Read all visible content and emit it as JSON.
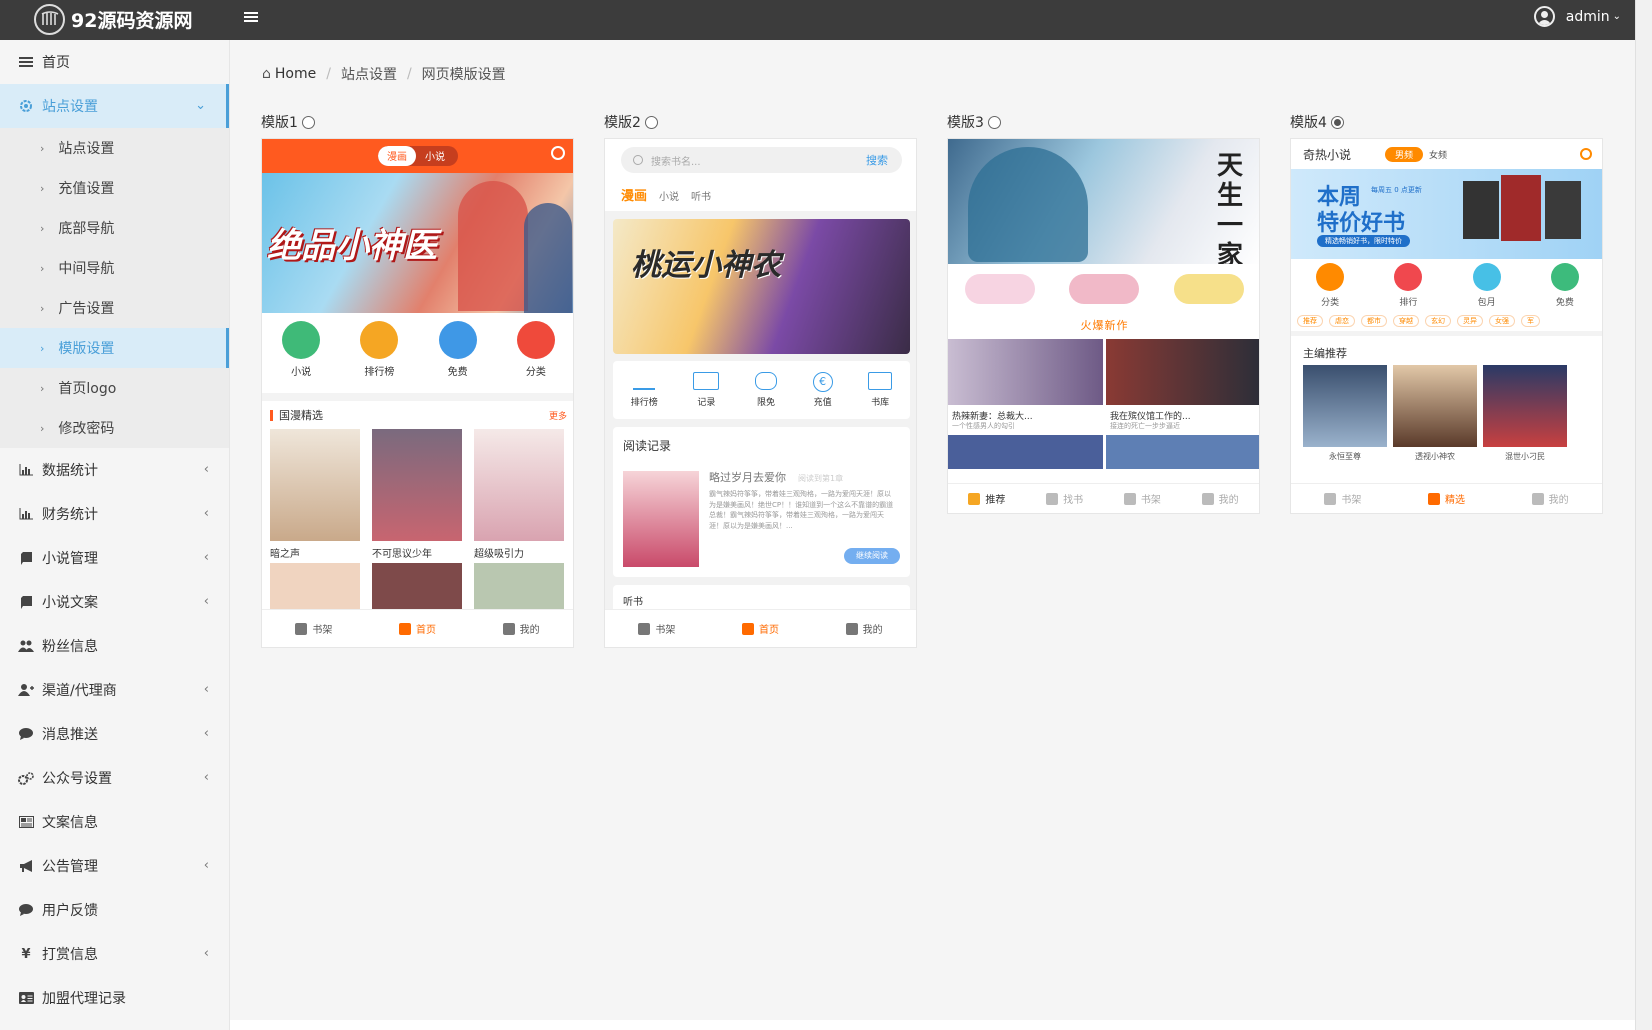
{
  "header": {
    "logo_text": "92源码资源网",
    "user": "admin"
  },
  "sidebar": {
    "items": [
      {
        "label": "首页",
        "icon": "list-icon"
      },
      {
        "label": "站点设置",
        "icon": "gear-icon"
      },
      {
        "label": "数据统计",
        "icon": "bar-chart-icon"
      },
      {
        "label": "财务统计",
        "icon": "bar-chart-icon"
      },
      {
        "label": "小说管理",
        "icon": "book-icon"
      },
      {
        "label": "小说文案",
        "icon": "book-icon"
      },
      {
        "label": "粉丝信息",
        "icon": "users-icon"
      },
      {
        "label": "渠道/代理商",
        "icon": "user-plus-icon"
      },
      {
        "label": "消息推送",
        "icon": "comment-icon"
      },
      {
        "label": "公众号设置",
        "icon": "cogs-icon"
      },
      {
        "label": "文案信息",
        "icon": "newspaper-icon"
      },
      {
        "label": "公告管理",
        "icon": "bullhorn-icon"
      },
      {
        "label": "用户反馈",
        "icon": "comment-icon"
      },
      {
        "label": "打赏信息",
        "icon": "yen-icon"
      },
      {
        "label": "加盟代理记录",
        "icon": "id-card-icon"
      }
    ],
    "sub_items": [
      "站点设置",
      "充值设置",
      "底部导航",
      "中间导航",
      "广告设置",
      "模版设置",
      "首页logo",
      "修改密码"
    ]
  },
  "breadcrumb": {
    "home": "Home",
    "level1": "站点设置",
    "level2": "网页模版设置"
  },
  "templates": [
    {
      "label": "模版1",
      "selected": false
    },
    {
      "label": "模版2",
      "selected": false
    },
    {
      "label": "模版3",
      "selected": false
    },
    {
      "label": "模版4",
      "selected": true
    }
  ],
  "t1": {
    "tab_active": "漫画",
    "tab_other": "小说",
    "banner_title": "绝品小神医",
    "icons": [
      "小说",
      "排行榜",
      "免费",
      "分类"
    ],
    "section": "国漫精选",
    "more": "更多",
    "books": [
      "暗之声",
      "不可思议少年",
      "超级吸引力"
    ],
    "tabs": [
      "书架",
      "首页",
      "我的"
    ]
  },
  "t2": {
    "search_placeholder": "搜索书名...",
    "search_btn": "搜索",
    "tabs_top": [
      "漫画",
      "小说",
      "听书"
    ],
    "banner_title": "桃运小神农",
    "icons": [
      "排行榜",
      "记录",
      "限免",
      "充值",
      "书库"
    ],
    "history_title": "阅读记录",
    "book_title": "略过岁月去爱你",
    "book_progress": "阅读到第1章",
    "book_desc": "霸气辣妈符筝筝，带着娃三观殉格，一路为爱闯天涯！原以为是嫌美画风！绝世CP！！谁知道到一个这么不靠谱的霸道总裁！霸气辣妈符筝筝，带着娃三观殉格，一路为爱闯天涯！原以为是嫌美画风！...",
    "continue_btn": "继续阅读",
    "partial": "听书",
    "tabs": [
      "书架",
      "首页",
      "我的"
    ]
  },
  "t3": {
    "banner_title": "天生一家",
    "section": "火爆新作",
    "cards": [
      "热辣新妻：总裁大...",
      "我在殡仪馆工作的..."
    ],
    "card_subs": [
      "一个性感男人的勾引",
      "接连的死亡一步步逼近"
    ],
    "tabs": [
      "推荐",
      "找书",
      "书架",
      "我的"
    ]
  },
  "t4": {
    "title": "奇热小说",
    "tab_active": "男频",
    "tab_other": "女频",
    "banner_l1": "本周",
    "banner_note": "每周五 0 点更新",
    "banner_l2": "特价好书",
    "banner_sub": "精选畅销好书，限时特价",
    "icons": [
      "分类",
      "排行",
      "包月",
      "免费"
    ],
    "tags": [
      "推荐",
      "虐恋",
      "都市",
      "穿越",
      "玄幻",
      "灵异",
      "女强",
      "军"
    ],
    "section": "主编推荐",
    "books": [
      "永恒至尊",
      "透视小神农",
      "混世小刁民"
    ],
    "tabs": [
      "书架",
      "精选",
      "我的"
    ]
  },
  "colors": {
    "accent": "#4a9fd8",
    "topbar": "#3c3c3c",
    "orange": "#ff6a00"
  }
}
